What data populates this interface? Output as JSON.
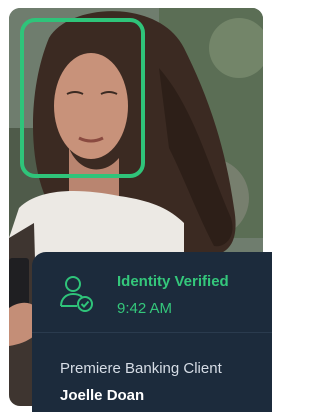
{
  "verification": {
    "status_label": "Identity Verified",
    "time": "9:42 AM",
    "icon": "user-check-icon"
  },
  "client": {
    "type": "Premiere Banking Client",
    "name": "Joelle Doan"
  },
  "colors": {
    "accent": "#2fc47a",
    "card_background": "#1c2b3c"
  }
}
